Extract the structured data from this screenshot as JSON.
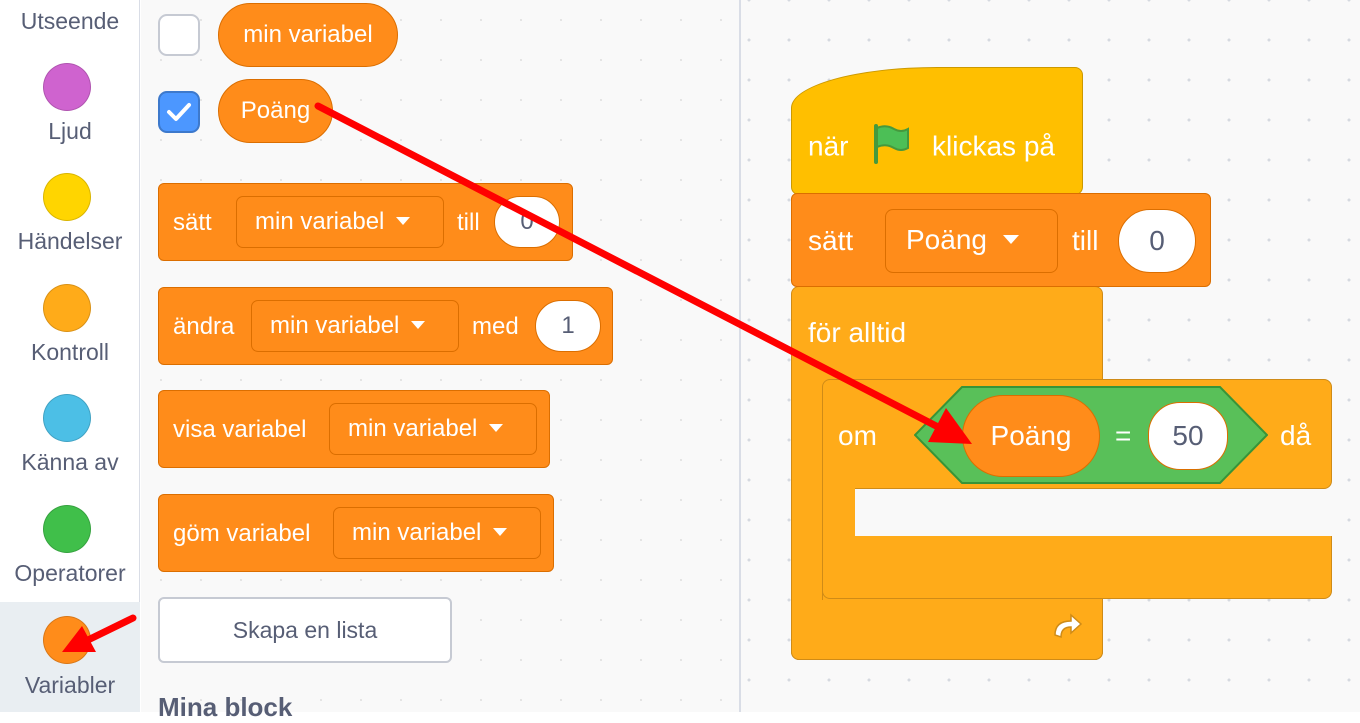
{
  "categories": [
    {
      "label": "Utseende",
      "color": "#9966ff"
    },
    {
      "label": "Ljud",
      "color": "#cf63cf"
    },
    {
      "label": "Händelser",
      "color": "#ffd500"
    },
    {
      "label": "Kontroll",
      "color": "#ffab19"
    },
    {
      "label": "Känna av",
      "color": "#4cbfe6"
    },
    {
      "label": "Operatorer",
      "color": "#40bf4a"
    },
    {
      "label": "Variabler",
      "color": "#ff8c1a"
    }
  ],
  "palette": {
    "variables": [
      {
        "name": "min variabel",
        "checked": false
      },
      {
        "name": "Poäng",
        "checked": true
      }
    ],
    "set_block": {
      "verb": "sätt",
      "variable": "min variabel",
      "to": "till",
      "value": "0"
    },
    "change_block": {
      "verb": "ändra",
      "variable": "min variabel",
      "by": "med",
      "value": "1"
    },
    "show_block": {
      "verb": "visa variabel",
      "variable": "min variabel"
    },
    "hide_block": {
      "verb": "göm variabel",
      "variable": "min variabel"
    },
    "make_list_button": "Skapa en lista",
    "my_blocks_heading": "Mina block"
  },
  "workspace": {
    "hat": {
      "prefix": "när",
      "icon": "green-flag-icon",
      "suffix": "klickas på"
    },
    "set_block": {
      "verb": "sätt",
      "variable": "Poäng",
      "to": "till",
      "value": "0"
    },
    "forever": {
      "label": "för alltid"
    },
    "if_block": {
      "prefix": "om",
      "left": "Poäng",
      "operator": "=",
      "right": "50",
      "suffix": "då"
    }
  },
  "colors": {
    "variables_orange": "#ff8c1a",
    "events_yellow": "#ffbf00",
    "control_orange": "#ffab19",
    "operators_green": "#59c059",
    "annotation_red": "#ff0000"
  }
}
